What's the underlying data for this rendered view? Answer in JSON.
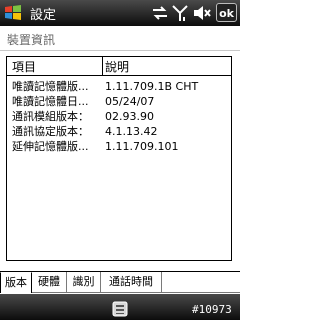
{
  "titlebar": {
    "title": "設定",
    "ok_label": "ok"
  },
  "section_title": "裝置資訊",
  "table": {
    "headers": [
      "項目",
      "說明"
    ],
    "rows": [
      [
        "唯讀記憶體版...",
        "1.11.709.1B CHT"
      ],
      [
        "唯讀記憶體日...",
        "05/24/07"
      ],
      [
        "通訊模組版本：",
        "02.93.90"
      ],
      [
        "通訊協定版本：",
        "4.1.13.42"
      ],
      [
        "延伸記憶體版...",
        "1.11.709.101"
      ]
    ]
  },
  "tabs": [
    "版本",
    "硬體",
    "識別",
    "通話時間"
  ],
  "active_tab": 0,
  "menubar": {
    "build_tag": "#10973"
  },
  "icons": [
    "windows-start-icon",
    "connectivity-icon",
    "signal-icon",
    "volume-icon",
    "keyboard-icon"
  ]
}
